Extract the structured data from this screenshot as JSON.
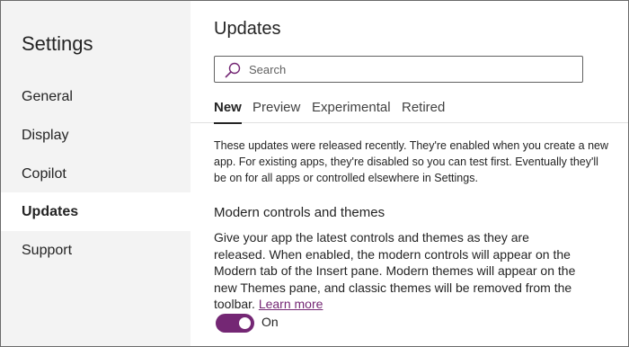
{
  "sidebar": {
    "title": "Settings",
    "items": [
      {
        "label": "General"
      },
      {
        "label": "Display"
      },
      {
        "label": "Copilot"
      },
      {
        "label": "Updates",
        "selected": true
      },
      {
        "label": "Support"
      }
    ]
  },
  "main": {
    "title": "Updates",
    "search": {
      "placeholder": "Search",
      "value": ""
    },
    "tabs": [
      {
        "label": "New",
        "active": true
      },
      {
        "label": "Preview"
      },
      {
        "label": "Experimental"
      },
      {
        "label": "Retired"
      }
    ],
    "intro": "These updates were released recently. They're enabled when you create a new app. For existing apps, they're disabled so you can test first. Eventually they'll be on for all apps or controlled elsewhere in Settings.",
    "feature": {
      "title": "Modern controls and themes",
      "description": "Give your app the latest controls and themes as they are released. When enabled, the modern controls will appear on the Modern tab of the Insert pane. Modern themes will appear on the new Themes pane, and classic themes will be removed from the toolbar.",
      "learn_more": "Learn more",
      "toggle_on": true,
      "toggle_label": "On"
    }
  },
  "colors": {
    "accent": "#742774",
    "sidebar_bg": "#f3f3f3",
    "text": "#242424"
  },
  "icons": {
    "search": "search-icon"
  }
}
